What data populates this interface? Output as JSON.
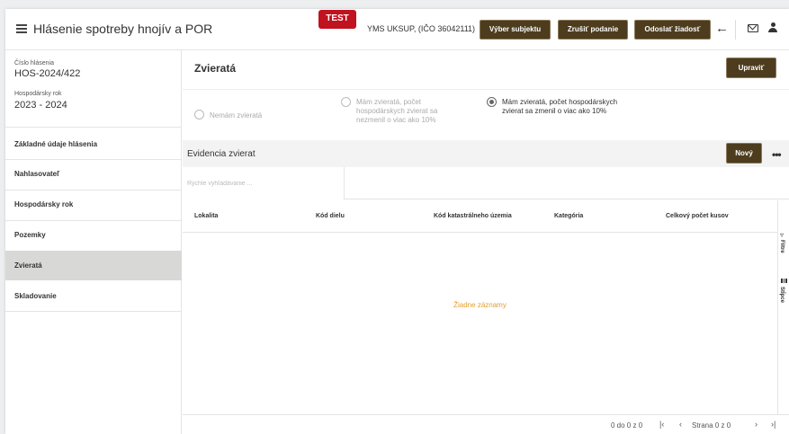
{
  "header": {
    "title": "Hlásenie spotreby hnojív a POR",
    "test_badge": "TEST",
    "subject": "YMS UKSUP, (IČO 36042111)",
    "btn_vyber": "Výber subjektu",
    "btn_zrusit": "Zrušiť podanie",
    "btn_odoslat": "Odoslať žiadosť"
  },
  "sidebar": {
    "cislo_label": "Číslo hlásenia",
    "cislo_value": "HOS-2024/422",
    "rok_label": "Hospodársky rok",
    "rok_value": "2023 - 2024",
    "items": [
      {
        "label": "Základné údaje hlásenia"
      },
      {
        "label": "Nahlasovateľ"
      },
      {
        "label": "Hospodársky rok"
      },
      {
        "label": "Pozemky"
      },
      {
        "label": "Zvieratá"
      },
      {
        "label": "Skladovanie"
      }
    ],
    "active_item": "Zvieratá"
  },
  "main": {
    "title": "Zvieratá",
    "btn_upravit": "Upraviť",
    "radios": [
      {
        "label": "Nemám zvieratá",
        "checked": false
      },
      {
        "label": "Mám zvieratá, počet hospodárskych zvierat sa nezmenil o viac ako 10%",
        "checked": false
      },
      {
        "label": "Mám zvieratá, počet hospodárskych zvierat sa zmenil o viac ako 10%",
        "checked": true
      }
    ],
    "list_title": "Evidencia zvierat",
    "btn_novy": "Nový",
    "search_placeholder": "Rýchle vyhľadávanie ...",
    "columns": [
      "Lokalita",
      "Kód dielu",
      "Kód katastrálneho územia",
      "Kategória",
      "Celkový počet kusov"
    ],
    "empty_message": "Žiadne záznamy",
    "side_tabs": [
      "Filtre",
      "Stĺpce"
    ],
    "pager": {
      "range": "0 do 0 z 0",
      "page": "Strana 0 z 0"
    }
  }
}
